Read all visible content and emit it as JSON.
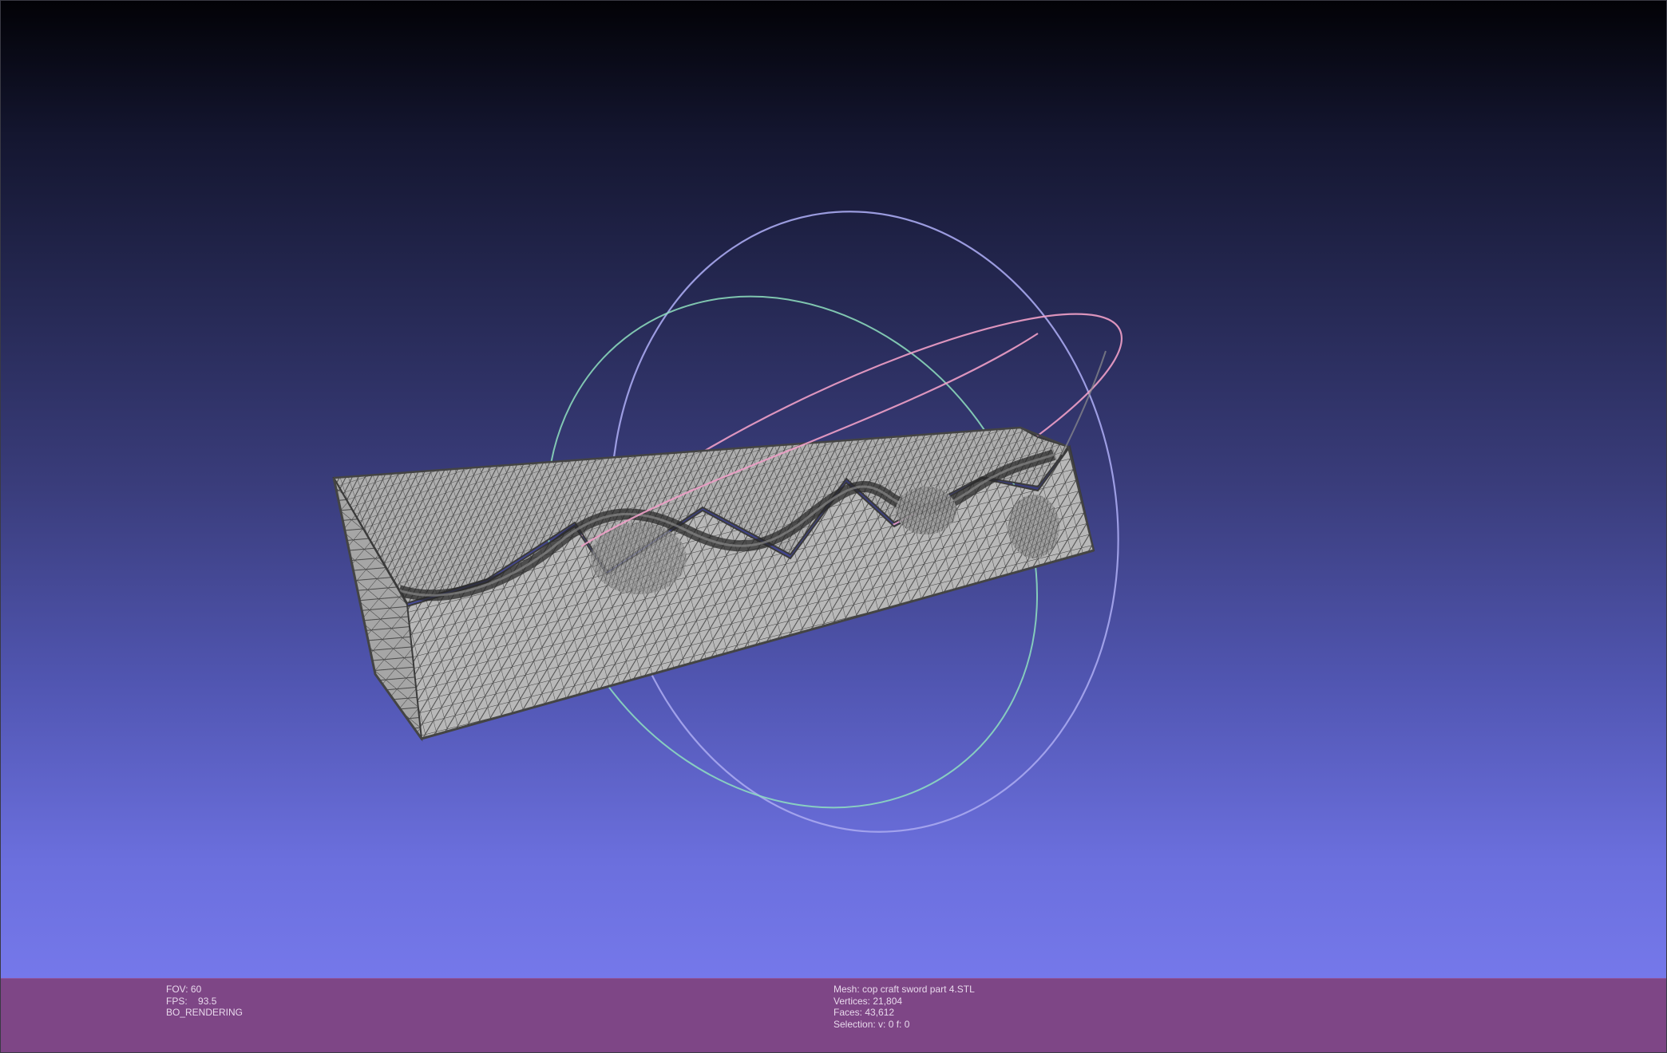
{
  "viewer": {
    "status_left": {
      "fov_label": "FOV:",
      "fov_value": "60",
      "fps_label": "FPS:",
      "fps_value": "93.5",
      "render_mode": "BO_RENDERING"
    },
    "status_right": {
      "mesh_label": "Mesh:",
      "mesh_name": "cop craft sword part 4.STL",
      "vertices_label": "Vertices:",
      "vertices_value": "21,804",
      "faces_label": "Faces:",
      "faces_value": "43,612",
      "selection_label": "Selection:",
      "selection_value": "v: 0 f: 0"
    }
  },
  "colors": {
    "viewport_top": "#020206",
    "viewport_bottom": "#7578ea",
    "info_bar": "#7e4686",
    "mesh_fill": "#b4b4b4",
    "mesh_wire": "#3c3c3c",
    "trackball_x_ring": "#f0a0c8",
    "trackball_y_ring": "#a8a8f0",
    "trackball_z_ring": "#90e8c0"
  },
  "icons": {
    "trackball": "trackball-gizmo-icon"
  }
}
